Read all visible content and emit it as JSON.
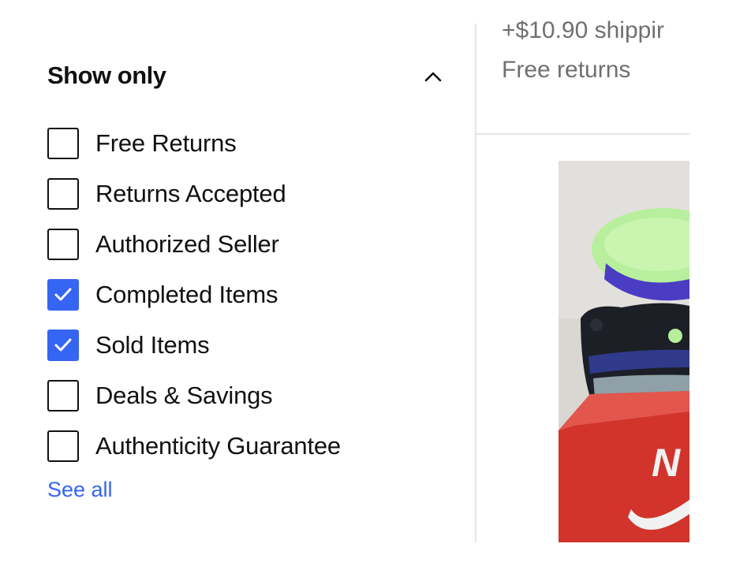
{
  "filters": {
    "section_title": "Show only",
    "see_all_label": "See all",
    "options": [
      {
        "label": "Free Returns",
        "checked": false
      },
      {
        "label": "Returns Accepted",
        "checked": false
      },
      {
        "label": "Authorized Seller",
        "checked": false
      },
      {
        "label": "Completed Items",
        "checked": true
      },
      {
        "label": "Sold Items",
        "checked": true
      },
      {
        "label": "Deals & Savings",
        "checked": false
      },
      {
        "label": "Authenticity Guarantee",
        "checked": false
      }
    ]
  },
  "listing": {
    "shipping_text": "+$10.90 shippir",
    "returns_text": "Free returns"
  },
  "icons": {
    "collapse": "chevron-up-icon",
    "checkmark": "check-icon"
  },
  "colors": {
    "accent": "#3665f3",
    "text": "#111111",
    "muted": "#707070",
    "divider": "#e5e5e5"
  }
}
